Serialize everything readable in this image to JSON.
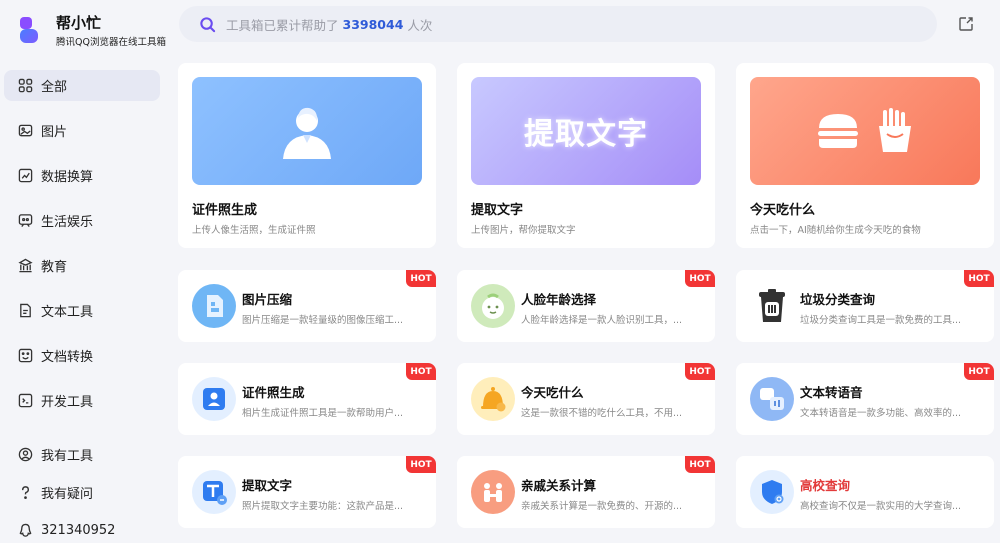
{
  "brand": {
    "name": "帮小忙",
    "subtitle": "腾讯QQ浏览器在线工具箱"
  },
  "nav": [
    {
      "label": "全部",
      "icon": "grid-icon",
      "active": true
    },
    {
      "label": "图片",
      "icon": "image-icon"
    },
    {
      "label": "数据换算",
      "icon": "chart-icon"
    },
    {
      "label": "生活娱乐",
      "icon": "entertainment-icon"
    },
    {
      "label": "教育",
      "icon": "education-icon"
    },
    {
      "label": "文本工具",
      "icon": "text-icon"
    },
    {
      "label": "文档转换",
      "icon": "document-icon"
    },
    {
      "label": "开发工具",
      "icon": "code-icon"
    }
  ],
  "nav_bottom": [
    {
      "label": "我有工具",
      "icon": "user-icon"
    },
    {
      "label": "我有疑问",
      "icon": "question-icon"
    },
    {
      "label": "321340952",
      "icon": "qq-icon"
    }
  ],
  "search": {
    "prefix": "工具箱已累计帮助了",
    "count": "3398044",
    "suffix": "人次"
  },
  "featured": [
    {
      "title": "证件照生成",
      "desc": "上传人像生活照，生成证件照",
      "banner_text": ""
    },
    {
      "title": "提取文字",
      "desc": "上传图片，帮你提取文字",
      "banner_text": "提取文字"
    },
    {
      "title": "今天吃什么",
      "desc": "点击一下，AI随机给你生成今天吃的食物",
      "banner_text": ""
    }
  ],
  "hot_label": "HOT",
  "tools": [
    {
      "title": "图片压缩",
      "desc": "图片压缩是一款轻量级的图像压缩工...",
      "hot": true
    },
    {
      "title": "人脸年龄选择",
      "desc": "人脸年龄选择是一款人脸识别工具，...",
      "hot": true
    },
    {
      "title": "垃圾分类查询",
      "desc": "垃圾分类查询工具是一款免费的工具...",
      "hot": true
    },
    {
      "title": "证件照生成",
      "desc": "相片生成证件照工具是一款帮助用户...",
      "hot": true
    },
    {
      "title": "今天吃什么",
      "desc": "这是一款很不错的吃什么工具，不用...",
      "hot": true
    },
    {
      "title": "文本转语音",
      "desc": "文本转语音是一款多功能、高效率的...",
      "hot": true
    },
    {
      "title": "提取文字",
      "desc": "照片提取文字主要功能：这款产品是...",
      "hot": true
    },
    {
      "title": "亲戚关系计算",
      "desc": "亲戚关系计算是一款免费的、开源的...",
      "hot": true
    },
    {
      "title": "高校查询",
      "desc": "高校查询不仅是一款实用的大学查询...",
      "hot": false
    }
  ]
}
